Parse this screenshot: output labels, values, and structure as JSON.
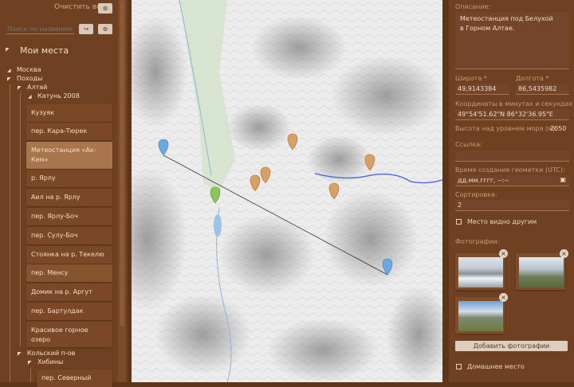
{
  "sidebar": {
    "clear_all": "Очистить всё",
    "search_placeholder": "Поиск по названию",
    "title": "Мои места",
    "tree": {
      "moscow": "Москва",
      "hikes": "Походы",
      "altai": "Алтай",
      "katun": "Катунь 2008",
      "kola": "Кольский п-ов",
      "khibiny": "Хибины"
    },
    "items": [
      "Кузуяк",
      "пер. Кара-Тюрек",
      "Метеостанция «Ак-Кем»",
      "р. Ярлу",
      "Аил на р. Ярлу",
      "пер. Ярлу-Боч",
      "пер. Сулу-Боч",
      "Стоянка на р. Текелю",
      "пер. Менсу",
      "Домик на р. Аргут",
      "пер. Бартулдак",
      "Красивое горное озеро",
      "пер. Северный"
    ]
  },
  "details": {
    "description_label": "Описание:",
    "description": "Метеостанция под Белухой\nв Горном Алтае.",
    "lat_label": "Широта *",
    "lat": "49,9143384",
    "lon_label": "Долгота *",
    "lon": "86,5435982",
    "dms_label": "Координаты в минутах и секундах",
    "dms": "49°54'51.62\"N 86°32'36.95\"E",
    "alt_label": "Высота над уровнем моря (м):",
    "alt": "2050",
    "link_label": "Ссылка:",
    "link": "",
    "time_label": "Время создания геометки (UTC):",
    "time_placeholder": "дд.мм.гггг, --:--",
    "sort_label": "Сортировка:",
    "sort": "2",
    "visible_label": "Место видно другим",
    "photos_label": "Фотографии:",
    "add_photos": "Добавить фотографии",
    "home_label": "Домашнее место"
  },
  "colors": {
    "panel": "#6f4122",
    "selected": "#a8754d",
    "route": "#5a6fd6"
  }
}
